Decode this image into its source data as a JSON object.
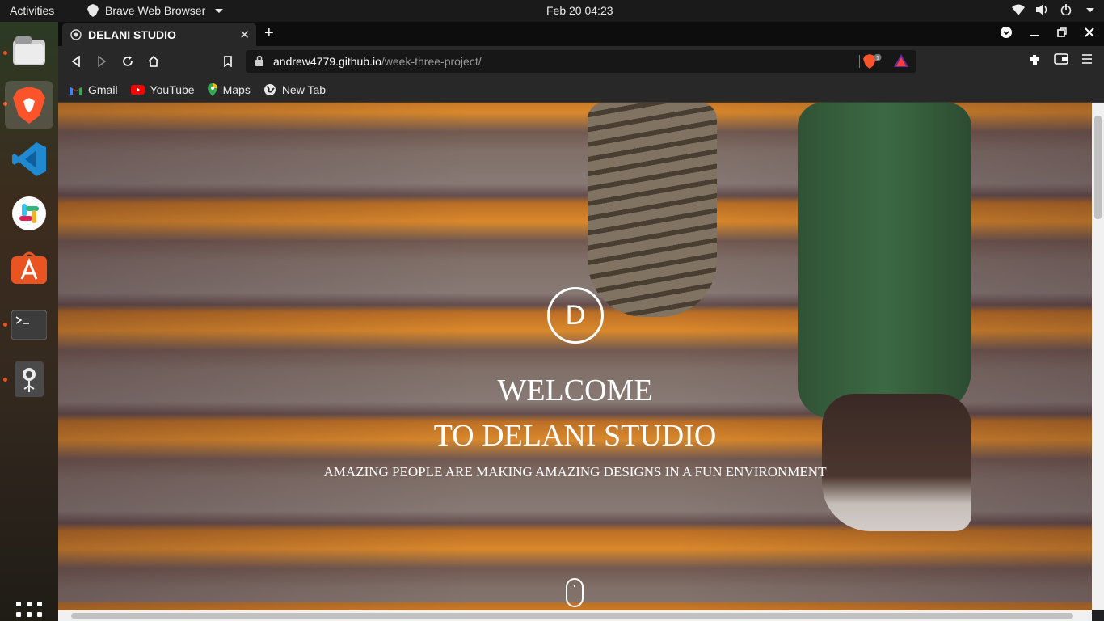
{
  "topbar": {
    "activities": "Activities",
    "app_name": "Brave Web Browser",
    "clock": "Feb 20  04:23"
  },
  "dock": {
    "items": [
      "files-icon",
      "brave-icon",
      "vscode-icon",
      "slack-icon",
      "software-center-icon",
      "terminal-icon",
      "map-pin-icon"
    ]
  },
  "browser": {
    "tab_title": "DELANI STUDIO",
    "url_host": "andrew4779.github.io",
    "url_path": "/week-three-project/",
    "shield_count": "1",
    "bookmarks": [
      {
        "label": "Gmail",
        "icon": "gmail-icon"
      },
      {
        "label": "YouTube",
        "icon": "youtube-icon"
      },
      {
        "label": "Maps",
        "icon": "maps-icon"
      },
      {
        "label": "New Tab",
        "icon": "globe-icon"
      }
    ]
  },
  "page": {
    "logo_letter": "D",
    "headline_1": "WELCOME",
    "headline_2": "TO DELANI STUDIO",
    "tagline": "AMAZING PEOPLE ARE MAKING AMAZING DESIGNS IN A FUN ENVIRONMENT"
  },
  "colors": {
    "accent": "#e95420",
    "stair_orange": "#f0972c",
    "topbar": "#1a1a1a"
  }
}
